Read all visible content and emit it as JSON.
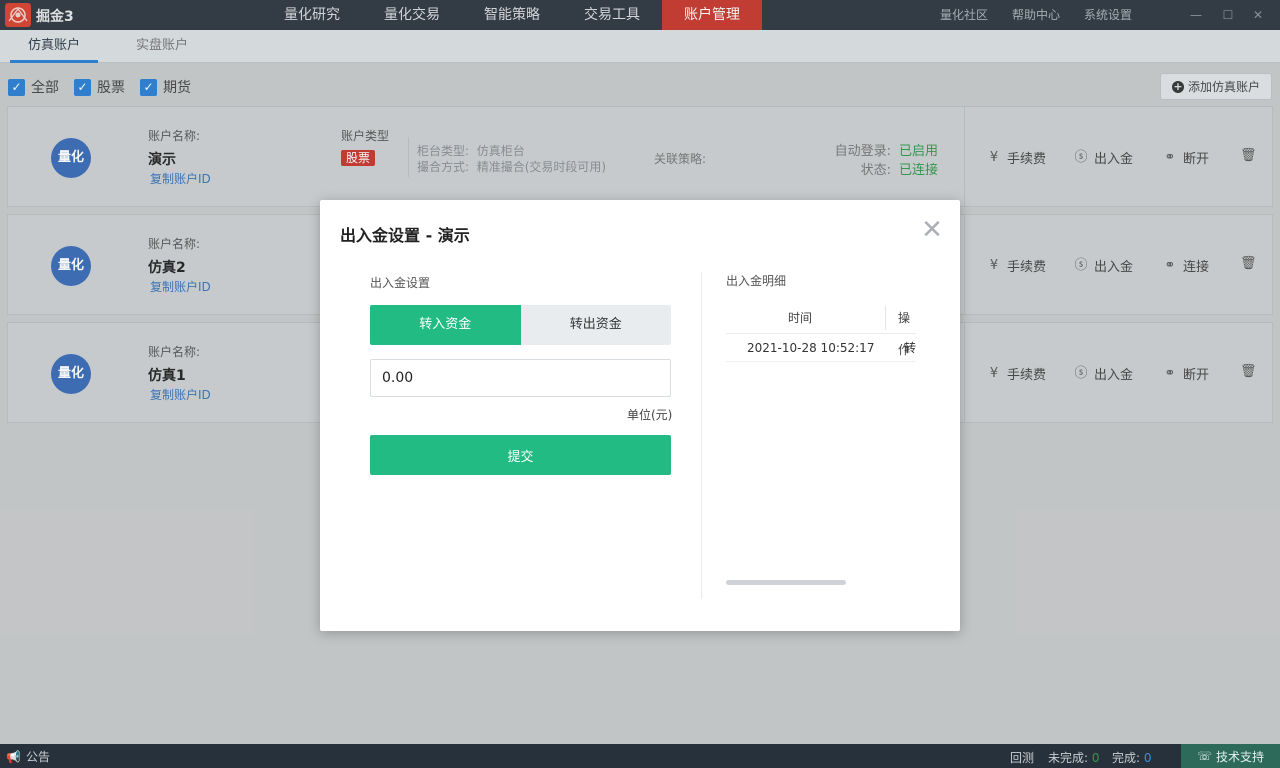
{
  "app": {
    "name": "掘金3"
  },
  "nav": [
    "量化研究",
    "量化交易",
    "智能策略",
    "交易工具",
    "账户管理"
  ],
  "nav_active": 4,
  "toplinks": [
    "量化社区",
    "帮助中心",
    "系统设置"
  ],
  "tabs": [
    "仿真账户",
    "实盘账户"
  ],
  "filters": [
    "全部",
    "股票",
    "期货"
  ],
  "add_account": "添加仿真账户",
  "labels": {
    "account_name": "账户名称:",
    "account_type": "账户类型",
    "copy_id": "复制账户ID",
    "counter_type": "柜台类型:",
    "counter_value": "仿真柜台",
    "match_mode": "撮合方式:",
    "match_value": "精准撮合(交易时段可用)",
    "assoc_strategy": "关联策略:",
    "auto_login": "自动登录:",
    "status": "状态:"
  },
  "accounts": [
    {
      "avatar": "量化",
      "name": "演示",
      "type": "股票",
      "auto_login": "已启用",
      "status": "已连接",
      "actions": [
        "手续费",
        "出入金",
        "断开"
      ]
    },
    {
      "avatar": "量化",
      "name": "仿真2",
      "actions": [
        "手续费",
        "出入金",
        "连接"
      ]
    },
    {
      "avatar": "量化",
      "name": "仿真1",
      "actions": [
        "手续费",
        "出入金",
        "断开"
      ]
    }
  ],
  "modal": {
    "title": "出入金设置 - 演示",
    "left_section": "出入金设置",
    "deposit": "转入资金",
    "withdraw": "转出资金",
    "amount": "0.00",
    "unit": "单位(元)",
    "submit": "提交",
    "right_section": "出入金明细",
    "columns": [
      "时间",
      "操作"
    ],
    "rows": [
      {
        "time": "2021-10-28 10:52:17",
        "op": "转入"
      }
    ]
  },
  "statusbar": {
    "notice": "公告",
    "backtest": "回测",
    "incomplete_label": "未完成:",
    "incomplete": "0",
    "complete_label": "完成:",
    "complete": "0",
    "support": "技术支持"
  },
  "colors": {
    "accent_green": "#22bb84",
    "nav_active": "#c8372d",
    "blue": "#2a7fd4"
  }
}
